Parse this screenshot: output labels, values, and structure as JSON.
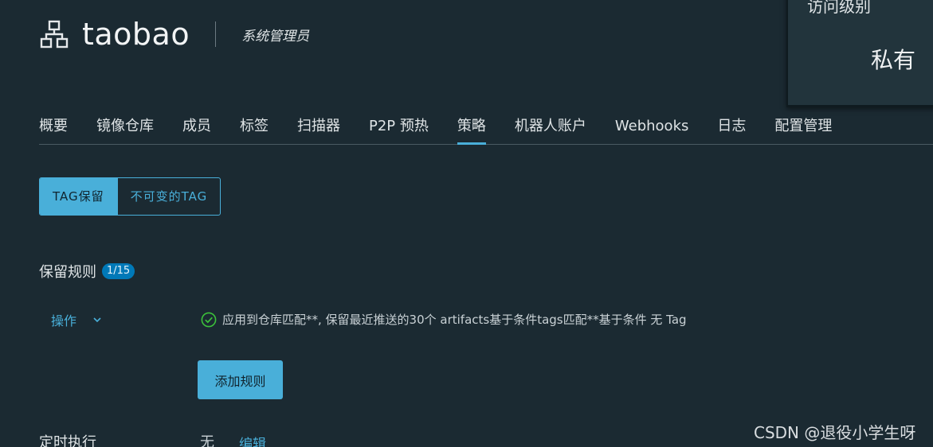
{
  "project": {
    "name": "taobao",
    "role": "系统管理员",
    "icon": "project-network-icon"
  },
  "access": {
    "label": "访问级别",
    "value": "私有"
  },
  "tabs": [
    {
      "label": "概要"
    },
    {
      "label": "镜像仓库"
    },
    {
      "label": "成员"
    },
    {
      "label": "标签"
    },
    {
      "label": "扫描器"
    },
    {
      "label": "P2P 预热"
    },
    {
      "label": "策略",
      "active": true
    },
    {
      "label": "机器人账户"
    },
    {
      "label": "Webhooks"
    },
    {
      "label": "日志"
    },
    {
      "label": "配置管理"
    }
  ],
  "subtabs": [
    {
      "label": "TAG保留",
      "active": true
    },
    {
      "label": "不可变的TAG"
    }
  ],
  "retention": {
    "title": "保留规则",
    "count": "1/15",
    "action_label": "操作",
    "rule_text": "应用到仓库匹配**, 保留最近推送的30个 artifacts基于条件tags匹配**基于条件 无 Tag",
    "add_rule_label": "添加规则"
  },
  "schedule": {
    "label": "定时执行",
    "value": "无",
    "edit_label": "编辑"
  },
  "watermark": "CSDN @退役小学生呀",
  "colors": {
    "background": "#1b2a32",
    "accent": "#49afd9",
    "badge": "#0079b8",
    "success": "#3cc13b"
  }
}
